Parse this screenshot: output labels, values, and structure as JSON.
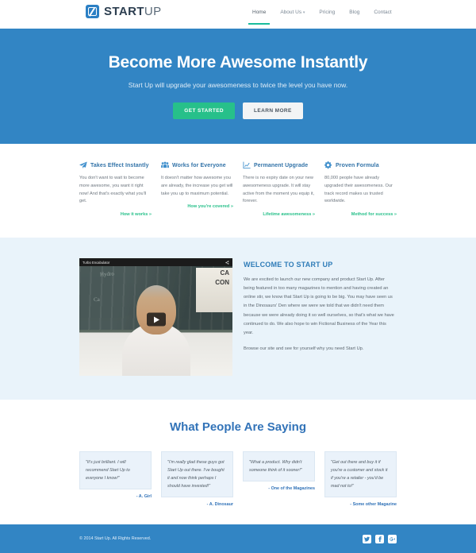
{
  "header": {
    "logo": {
      "bold": "START",
      "light": "UP",
      "icon": "logo-mark-icon"
    },
    "nav": [
      {
        "label": "Home",
        "active": true
      },
      {
        "label": "About Us",
        "caret": "▾",
        "active": false
      },
      {
        "label": "Pricing",
        "active": false
      },
      {
        "label": "Blog",
        "active": false
      },
      {
        "label": "Contact",
        "active": false
      }
    ]
  },
  "hero": {
    "heading": "Become More Awesome Instantly",
    "subheading": "Start Up will upgrade your awesomeness to twice the level you have now.",
    "primary_button": "GET STARTED",
    "secondary_button": "LEARN MORE",
    "bg_color": "#3285c4",
    "primary_color": "#27c08a"
  },
  "features": [
    {
      "icon": "paper-plane-icon",
      "title": "Takes Effect Instantly",
      "body": "You don't want to wait to become more awesome, you want it right now! And that's exactly what you'll get.",
      "link": "How it works »"
    },
    {
      "icon": "group-people-icon",
      "title": "Works for Everyone",
      "body": "It doesn't matter how awesome you are already, the increase you get will take you up to maximum potential.",
      "link": "How you're covered »"
    },
    {
      "icon": "line-chart-icon",
      "title": "Permanent Upgrade",
      "body": "There is no expiry date on your new awesomeness upgrade. It will stay active from the moment you equip it, forever.",
      "link": "Lifetime awesomeness »"
    },
    {
      "icon": "gears-icon",
      "title": "Proven Formula",
      "body": "80,000 people have already upgraded their awesomeness. Our track record makes us trusted worldwide.",
      "link": "Method for success »"
    }
  ],
  "welcome": {
    "video": {
      "title": "Turbo Encabulator",
      "share_icon": "share-icon",
      "play_icon": "play-icon",
      "chalk_1": "Hydro",
      "chalk_2": "Ca",
      "card_1": "CA",
      "card_2": "CON"
    },
    "heading": "WELCOME TO START UP",
    "paragraph_1": "We are excited to launch our new company and product Start Up. After being featured in too many magazines to mention and having created an online stir, we know that Start Up is going to be big. You may have seen us in the Dinosaurs' Den where we were we told that we didn't need them because we were already doing it so well ourselves, so that's what we have continued to do. We also hope to win Fictional Business of the Year this year.",
    "paragraph_2": "Browse our site and see for yourself why you need Start Up."
  },
  "testimonials": {
    "heading": "What People Are Saying",
    "items": [
      {
        "quote": "\"It's just brilliant. I will recommend Start Up to everyone I know!\"",
        "attrib": "- A. Girl"
      },
      {
        "quote": "\"I'm really glad these guys got Start Up out there. I've bought it and now think perhaps I should have invested!\"",
        "attrib": "- A. Dinosaur"
      },
      {
        "quote": "\"What a product. Why didn't someone think of it sooner!\"",
        "attrib": "- One of the Magazines"
      },
      {
        "quote": "\"Get out there and buy it if you're a customer and stock it if you're a retailer - you'd be mad not to!\"",
        "attrib": "- Some other Magazine"
      }
    ]
  },
  "footer": {
    "copyright": "© 2014 Start Up. All Rights Reserved.",
    "socials": [
      {
        "name": "twitter-icon"
      },
      {
        "name": "facebook-icon"
      },
      {
        "name": "googleplus-icon"
      }
    ]
  }
}
